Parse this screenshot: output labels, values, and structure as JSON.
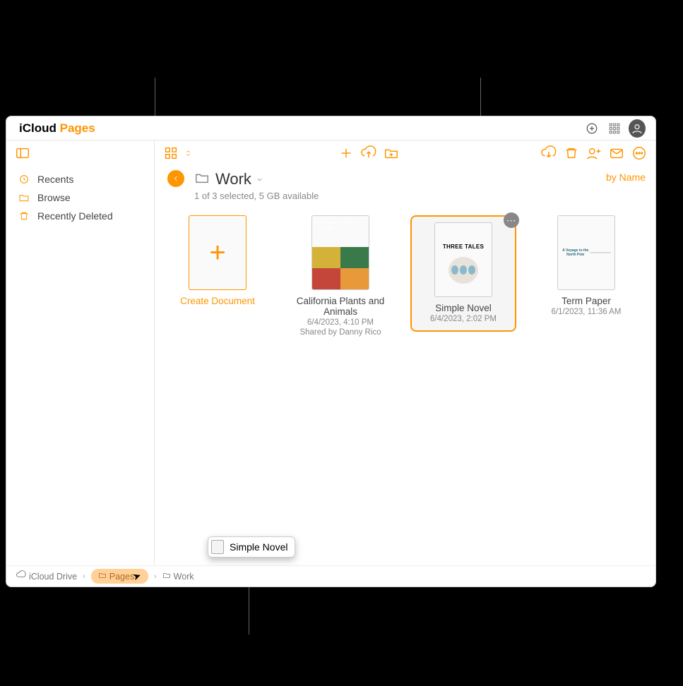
{
  "brand": {
    "prefix": "iCloud ",
    "suffix": "Pages"
  },
  "sidebar": {
    "items": [
      {
        "label": "Recents",
        "icon": "clock-icon"
      },
      {
        "label": "Browse",
        "icon": "folder-icon"
      },
      {
        "label": "Recently Deleted",
        "icon": "trash-icon"
      }
    ]
  },
  "header": {
    "folder_name": "Work",
    "status": "1 of 3 selected, 5 GB available",
    "sort_label": "by Name"
  },
  "create_tile": {
    "label": "Create Document"
  },
  "documents": [
    {
      "name": "California Plants and Animals",
      "date": "6/4/2023, 4:10 PM",
      "shared": "Shared by Danny Rico",
      "thumb_text": "California Plants and Animals"
    },
    {
      "name": "Simple Novel",
      "date": "6/4/2023, 2:02 PM",
      "thumb_text": "THREE TALES",
      "selected": true
    },
    {
      "name": "Term Paper",
      "date": "6/1/2023, 11:36 AM",
      "thumb_text": "A Voyage to the North Pole"
    }
  ],
  "drag_tooltip": {
    "label": "Simple Novel"
  },
  "breadcrumb": {
    "items": [
      {
        "label": "iCloud Drive"
      },
      {
        "label": "Pages",
        "highlight": true
      },
      {
        "label": "Work"
      }
    ]
  }
}
